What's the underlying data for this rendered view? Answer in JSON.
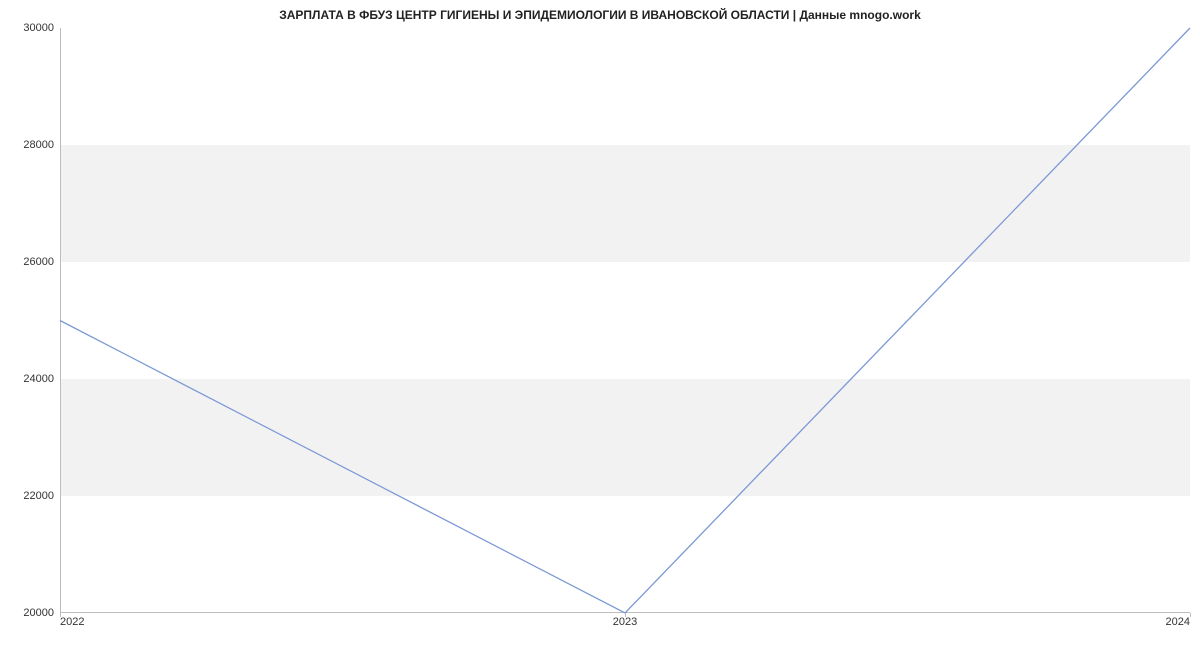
{
  "chart_data": {
    "type": "line",
    "title": "ЗАРПЛАТА В ФБУЗ ЦЕНТР ГИГИЕНЫ И ЭПИДЕМИОЛОГИИ В ИВАНОВСКОЙ ОБЛАСТИ | Данные mnogo.work",
    "x": [
      2022,
      2023,
      2024
    ],
    "values": [
      25000,
      20000,
      30000
    ],
    "x_ticks": [
      2022,
      2023,
      2024
    ],
    "y_ticks": [
      20000,
      22000,
      24000,
      26000,
      28000,
      30000
    ],
    "xlim": [
      2022,
      2024
    ],
    "ylim": [
      20000,
      30000
    ],
    "xlabel": "",
    "ylabel": "",
    "line_color": "#7b98d6",
    "band_color": "#f2f2f2"
  }
}
